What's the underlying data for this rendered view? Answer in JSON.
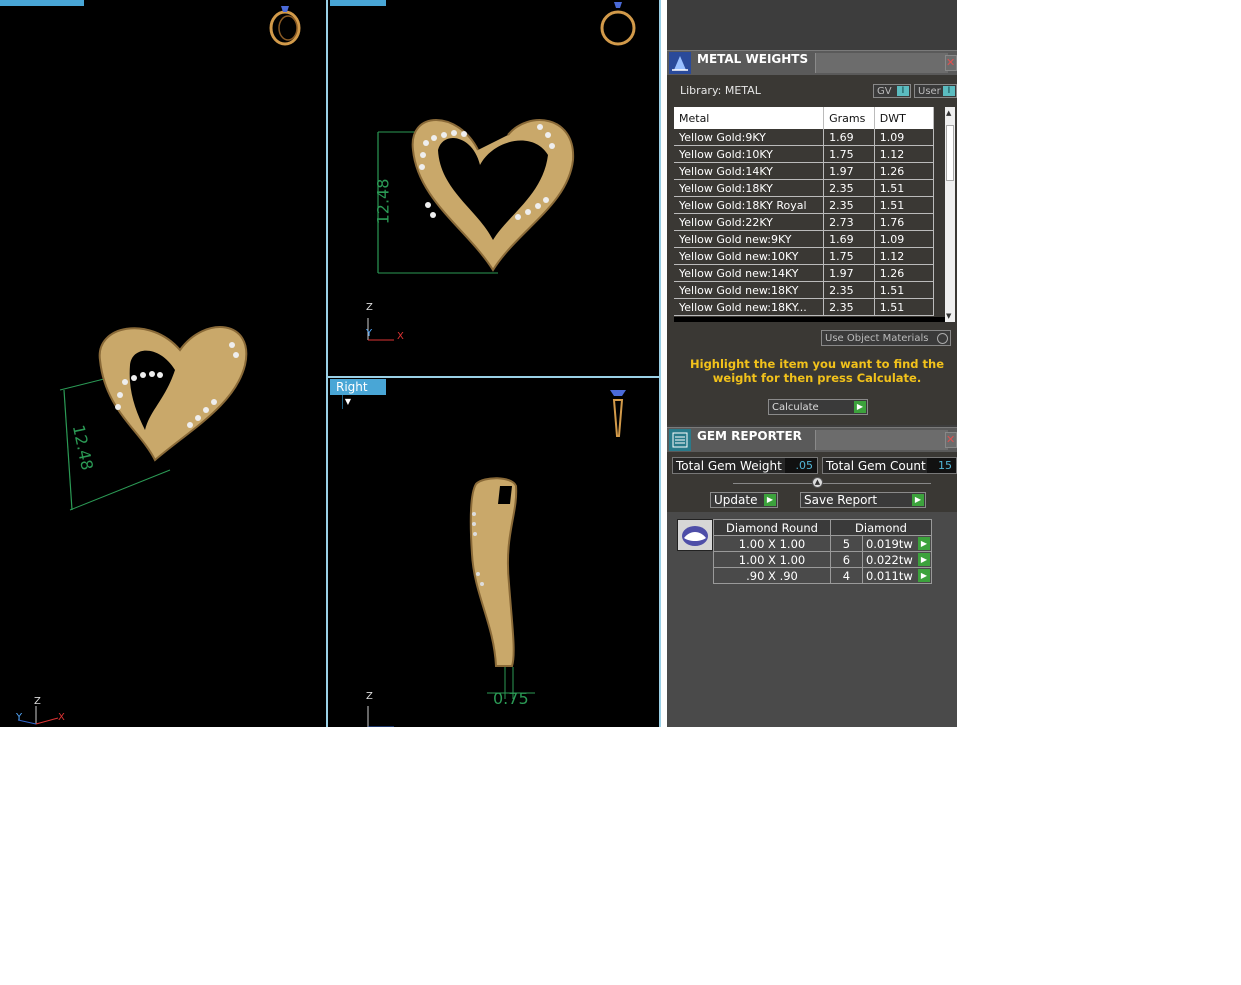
{
  "viewports": {
    "right_label": "Right",
    "dimension_a": "12.48",
    "dimension_b": "12.48",
    "dimension_c": "0.75",
    "axis_z": "Z",
    "axis_x": "X",
    "axis_y": "Y"
  },
  "metal_weights": {
    "title": "METAL WEIGHTS",
    "library": "Library: METAL",
    "toggle_gv": "GV",
    "toggle_user": "User",
    "columns": [
      "Metal",
      "Grams",
      "DWT"
    ],
    "rows": [
      {
        "metal": "Yellow Gold:9KY",
        "grams": "1.69",
        "dwt": "1.09"
      },
      {
        "metal": "Yellow Gold:10KY",
        "grams": "1.75",
        "dwt": "1.12"
      },
      {
        "metal": "Yellow Gold:14KY",
        "grams": "1.97",
        "dwt": "1.26"
      },
      {
        "metal": "Yellow Gold:18KY",
        "grams": "2.35",
        "dwt": "1.51"
      },
      {
        "metal": "Yellow Gold:18KY Royal",
        "grams": "2.35",
        "dwt": "1.51"
      },
      {
        "metal": "Yellow Gold:22KY",
        "grams": "2.73",
        "dwt": "1.76"
      },
      {
        "metal": "Yellow Gold new:9KY",
        "grams": "1.69",
        "dwt": "1.09"
      },
      {
        "metal": "Yellow Gold new:10KY",
        "grams": "1.75",
        "dwt": "1.12"
      },
      {
        "metal": "Yellow Gold new:14KY",
        "grams": "1.97",
        "dwt": "1.26"
      },
      {
        "metal": "Yellow Gold new:18KY",
        "grams": "2.35",
        "dwt": "1.51"
      },
      {
        "metal": "Yellow Gold new:18KY...",
        "grams": "2.35",
        "dwt": "1.51"
      }
    ],
    "use_object_materials": "Use Object Materials",
    "hint": "Highlight the item you want to find the weight for then press Calculate.",
    "calculate": "Calculate"
  },
  "gem_reporter": {
    "title": "GEM REPORTER",
    "total_weight_label": "Total Gem Weight",
    "total_weight_value": ".05",
    "total_count_label": "Total Gem Count",
    "total_count_value": "15",
    "update_label": "Update",
    "save_label": "Save Report",
    "table_header": {
      "shape": "Diamond Round",
      "material": "Diamond"
    },
    "rows": [
      {
        "size": "1.00 X 1.00",
        "count": "5",
        "weight": "0.019tw"
      },
      {
        "size": "1.00 X 1.00",
        "count": "6",
        "weight": "0.022tw"
      },
      {
        "size": ".90 X .90",
        "count": "4",
        "weight": "0.011tw"
      }
    ]
  },
  "colors": {
    "accent": "#49a6d6",
    "hint": "#f2c21b",
    "dimension": "#2b9a55",
    "gold": "#c9a86a"
  }
}
